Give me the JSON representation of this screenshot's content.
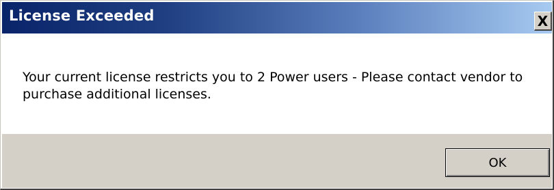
{
  "window": {
    "title": "License Exceeded",
    "close_label": "X"
  },
  "message": {
    "text": "Your current license restricts you to 2 Power users - Please contact vendor to purchase additional licenses."
  },
  "buttons": {
    "ok_label": "OK"
  },
  "colors": {
    "titlebar_start": "#0a246a",
    "titlebar_end": "#a6caf0",
    "button_face": "#d4d0c8",
    "content_background": "#ffffff"
  }
}
